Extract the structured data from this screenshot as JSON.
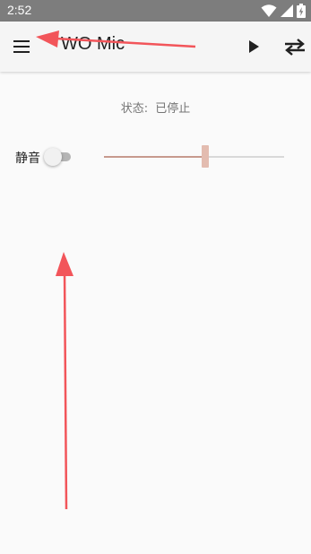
{
  "status_bar": {
    "time": "2:52",
    "icons": [
      "wifi-icon",
      "signal-icon",
      "battery-icon"
    ]
  },
  "app_bar": {
    "title": "WO Mic",
    "menu_icon": "menu-icon",
    "play_icon": "play-icon",
    "switch_icon": "swap-icon"
  },
  "content": {
    "status_label": "状态:",
    "status_value": "已停止",
    "mute_label": "静音",
    "mute_on": false,
    "volume_fraction": 0.56
  },
  "colors": {
    "status_bar": "#7d7d7d",
    "app_bar": "#f5f5f5",
    "slider_fill": "#c79a8e",
    "slider_knob": "#e3bcb0",
    "annotation_arrow": "#f2555a"
  }
}
